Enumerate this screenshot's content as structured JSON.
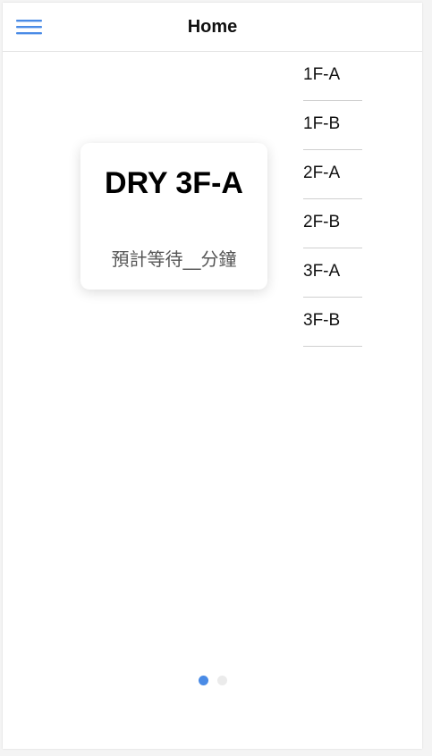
{
  "header": {
    "title": "Home",
    "menu_icon": "hamburger-menu-icon"
  },
  "card": {
    "title": "DRY 3F-A",
    "subtitle": "預計等待__分鐘"
  },
  "floors": [
    {
      "label": "1F-A"
    },
    {
      "label": "1F-B"
    },
    {
      "label": "2F-A"
    },
    {
      "label": "2F-B"
    },
    {
      "label": "3F-A"
    },
    {
      "label": "3F-B"
    }
  ],
  "pagination": {
    "active_index": 0,
    "total": 2
  },
  "colors": {
    "accent": "#4a8be6",
    "dot_inactive": "#ebebeb",
    "divider": "#cfcfcf"
  }
}
